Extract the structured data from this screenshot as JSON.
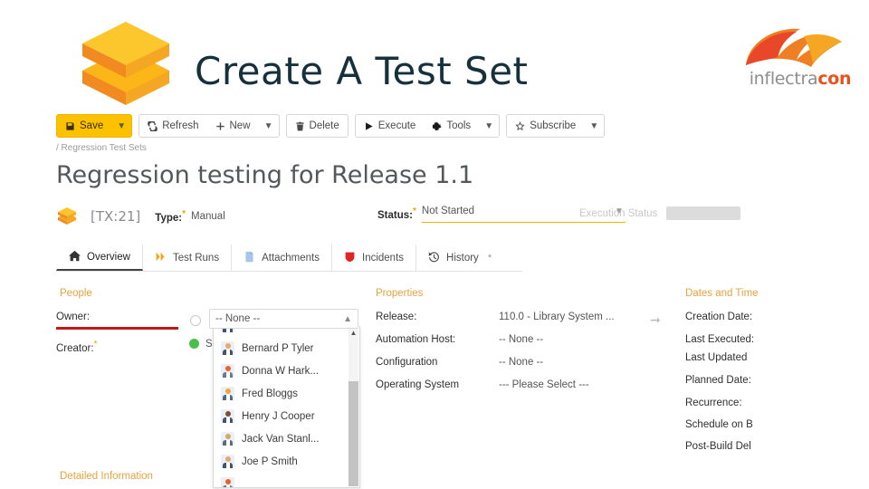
{
  "header": {
    "title": "Create A Test Set",
    "logo_icon": "stacked-boxes-logo",
    "brand_light": "inflectra",
    "brand_bold": "con"
  },
  "toolbar": {
    "groups": [
      {
        "items": [
          {
            "label": "Save",
            "icon": "floppy-disk-icon",
            "caret": true
          }
        ],
        "primary": true
      },
      {
        "items": [
          {
            "label": "Refresh",
            "icon": "refresh-icon",
            "caret": false
          },
          {
            "label": "New",
            "icon": "plus-icon",
            "caret": true
          }
        ]
      },
      {
        "items": [
          {
            "label": "Delete",
            "icon": "trash-icon",
            "caret": false
          }
        ]
      },
      {
        "items": [
          {
            "label": "Execute",
            "icon": "play-icon",
            "caret": false
          },
          {
            "label": "Tools",
            "icon": "gear-icon",
            "caret": true
          }
        ]
      },
      {
        "items": [
          {
            "label": "Subscribe",
            "icon": "star-icon",
            "caret": true
          }
        ]
      }
    ]
  },
  "breadcrumb": "/ Regression Test Sets",
  "artifact": {
    "title": "Regression testing for Release 1.1",
    "icon": "test-set-icon",
    "id": "[TX:21]",
    "type_label": "Type:",
    "type_value": "Manual",
    "status_label": "Status:",
    "status_value": "Not Started",
    "execution_status_label": "Execution Status",
    "required_marker": "*"
  },
  "tabs": [
    {
      "label": "Overview",
      "icon": "home-icon",
      "active": true
    },
    {
      "label": "Test Runs",
      "icon": "double-chevron-icon",
      "active": false
    },
    {
      "label": "Attachments",
      "icon": "document-icon",
      "active": false
    },
    {
      "label": "Incidents",
      "icon": "shield-icon",
      "active": false
    },
    {
      "label": "History",
      "icon": "history-icon",
      "active": false,
      "suffix": "*"
    }
  ],
  "people": {
    "heading": "People",
    "owner_label": "Owner:",
    "creator_label": "Creator:",
    "creator_value": "S",
    "required_marker": "*"
  },
  "owner_dropdown": {
    "selected": "-- None --",
    "caret_icon": "chevron-up-icon",
    "scroll_up_icon": "chevron-up-icon",
    "options": [
      "Bernard P Tyler",
      "Donna W Hark...",
      "Fred Bloggs",
      "Henry J Cooper",
      "Jack Van Stanl...",
      "Joe P Smith"
    ]
  },
  "properties": {
    "heading": "Properties",
    "rows": [
      {
        "label": "Release:",
        "value": "110.0 - Library System ...",
        "link_icon": "arrow-right-icon"
      },
      {
        "label": "Automation Host:",
        "value": "-- None --"
      },
      {
        "label": "Configuration",
        "value": "-- None --"
      },
      {
        "label": "Operating System",
        "value": "--- Please Select ---"
      }
    ]
  },
  "dates": {
    "heading": "Dates and Time",
    "rows": [
      "Creation Date:",
      "Last Executed:",
      "Last Updated",
      "Planned Date:",
      "Recurrence:",
      "Schedule on B",
      "Post-Build Del"
    ]
  },
  "detailed_information": "Detailed Information",
  "colors": {
    "accent_yellow": "#fcc200",
    "brand_orange": "#e8521f",
    "title_navy": "#16303c",
    "section_heading": "#e8a33d",
    "error_red": "#c11818",
    "ok_green": "#4bbf4b"
  }
}
